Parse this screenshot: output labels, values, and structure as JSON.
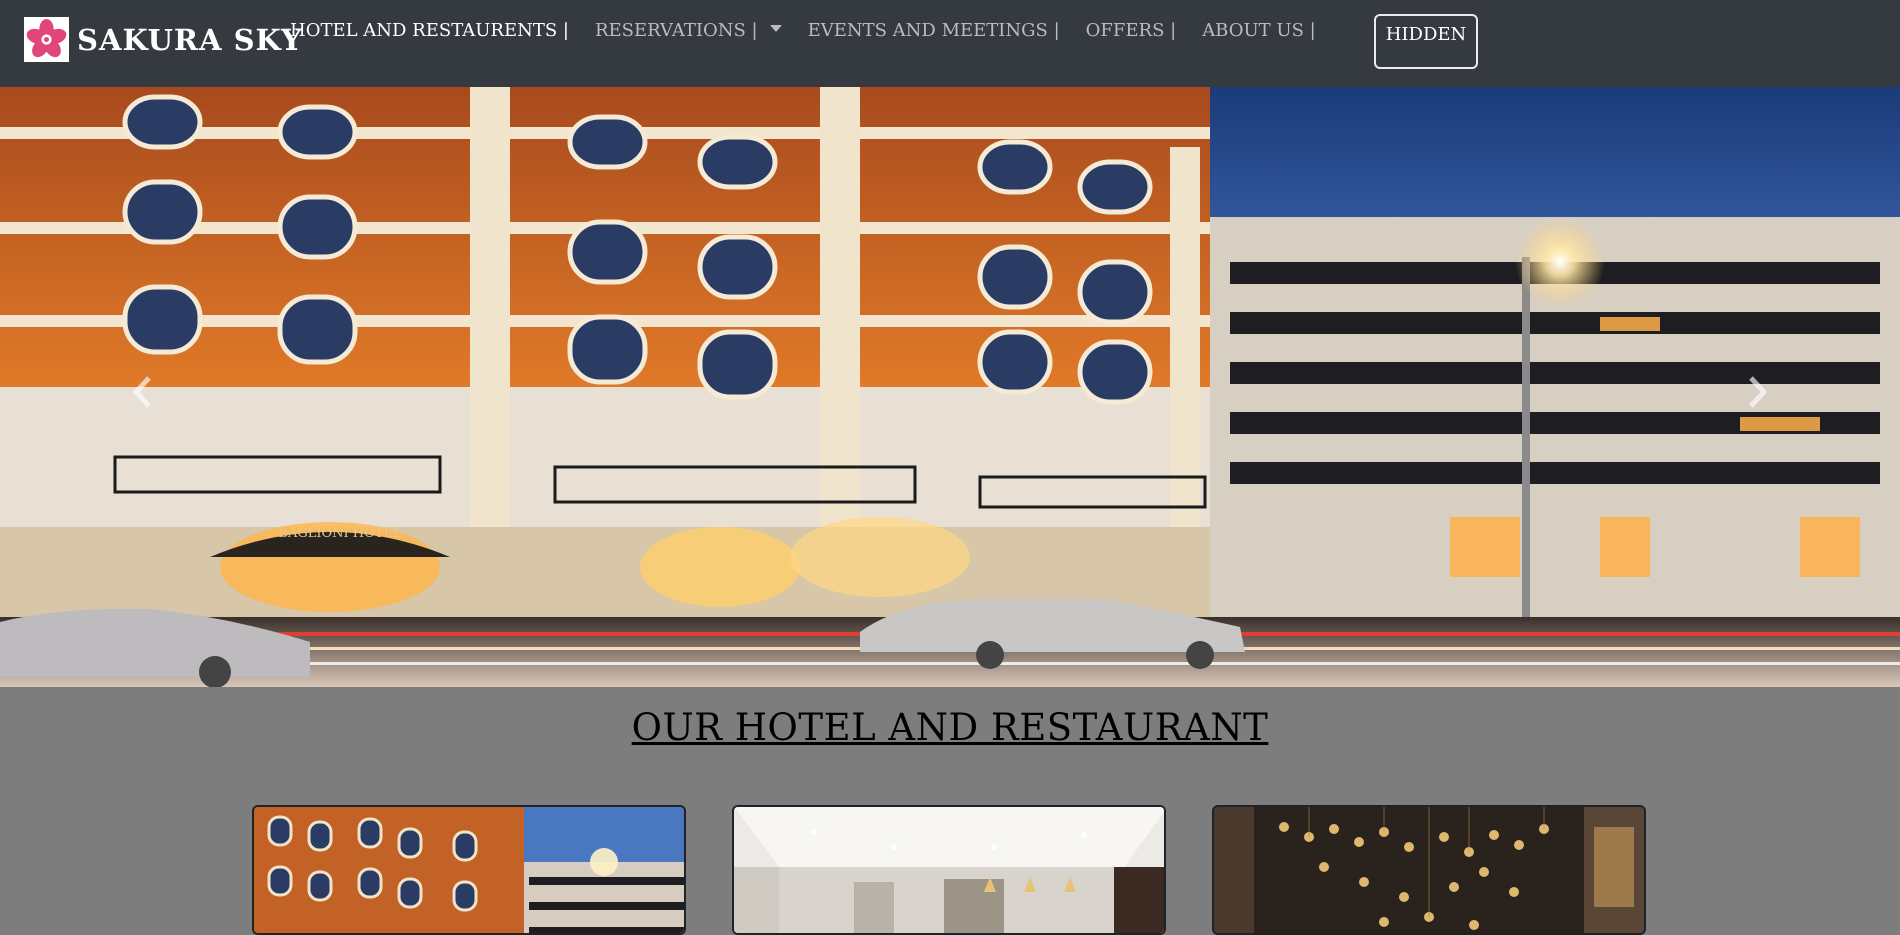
{
  "navbar": {
    "brand_text": "SAKURA SKY",
    "logo_icon": "sakura-flower-icon",
    "links": [
      {
        "label": "HOTEL AND RESTAURENTS |",
        "active": true
      },
      {
        "label": "RESERVATIONS |",
        "dropdown": true
      },
      {
        "label": "EVENTS AND MEETINGS |"
      },
      {
        "label": "OFFERS |"
      },
      {
        "label": "ABOUT US |"
      }
    ],
    "hidden_button_label": "HIDDEN"
  },
  "hero": {
    "prev_icon": "chevron-left-icon",
    "next_icon": "chevron-right-icon",
    "sign_text": "BAGLIONI HOTEL"
  },
  "section": {
    "title": "OUR HOTEL AND RESTAURANT",
    "cards": [
      {
        "image": "hotel-exterior-image"
      },
      {
        "image": "hotel-interior-lounge-image"
      },
      {
        "image": "restaurant-chandelier-image"
      }
    ]
  },
  "colors": {
    "navbar_bg": "#343a40",
    "page_bg": "#7d7d7d",
    "logo_accent": "#e0457b"
  }
}
